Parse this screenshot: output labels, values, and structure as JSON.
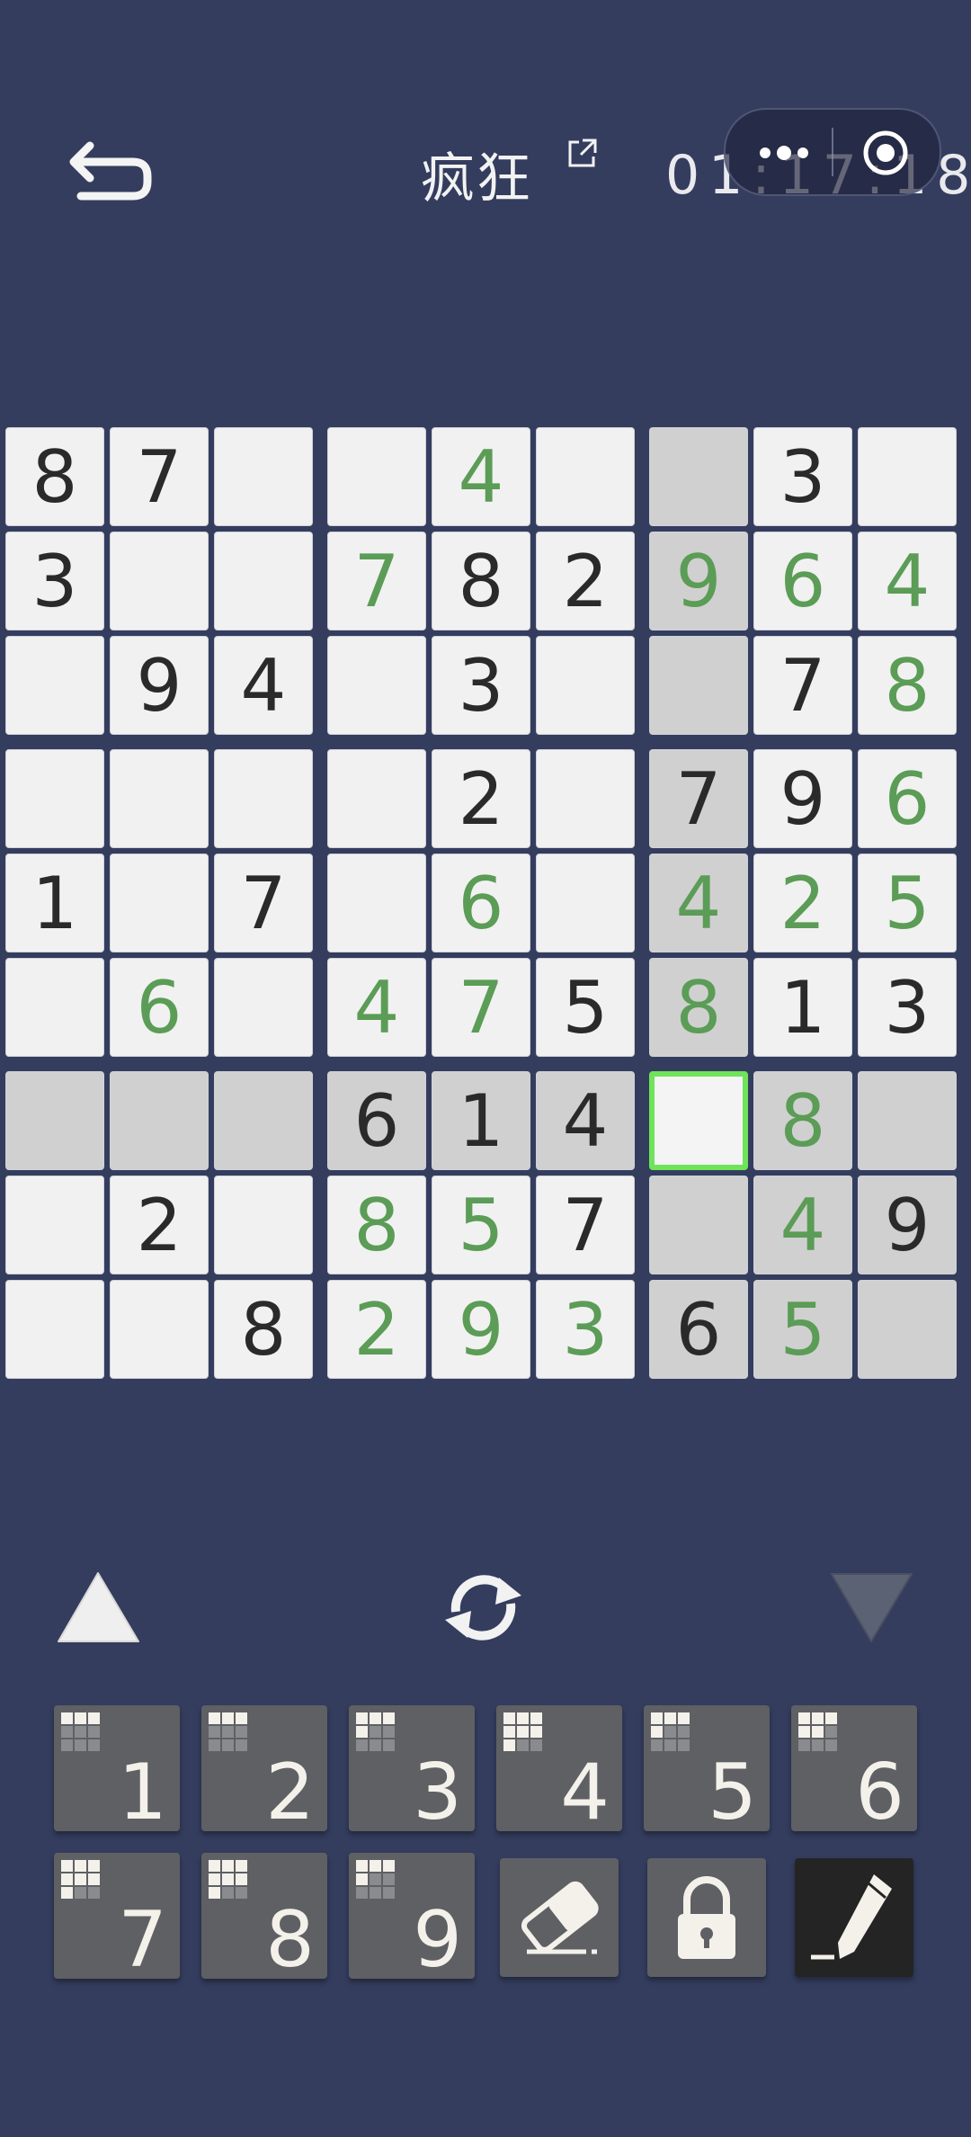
{
  "header": {
    "title": "疯狂",
    "timer": "01:17:18"
  },
  "board": {
    "rows": [
      [
        "8",
        "7",
        "",
        "",
        "4",
        "",
        "",
        "3",
        ""
      ],
      [
        "3",
        "",
        "",
        "7",
        "8",
        "2",
        "9",
        "6",
        "4"
      ],
      [
        "",
        "9",
        "4",
        "",
        "3",
        "",
        "",
        "7",
        "8"
      ],
      [
        "",
        "",
        "",
        "",
        "2",
        "",
        "7",
        "9",
        "6"
      ],
      [
        "1",
        "",
        "7",
        "",
        "6",
        "",
        "4",
        "2",
        "5"
      ],
      [
        "",
        "6",
        "",
        "4",
        "7",
        "5",
        "8",
        "1",
        "3"
      ],
      [
        "",
        "",
        "",
        "6",
        "1",
        "4",
        "",
        "8",
        ""
      ],
      [
        "",
        "2",
        "",
        "8",
        "5",
        "7",
        "",
        "4",
        "9"
      ],
      [
        "",
        "",
        "8",
        "2",
        "9",
        "3",
        "6",
        "5",
        ""
      ]
    ],
    "user_filled": [
      "0,4",
      "1,3",
      "1,6",
      "1,7",
      "1,8",
      "2,8",
      "3,8",
      "4,4",
      "4,6",
      "4,7",
      "4,8",
      "5,1",
      "5,3",
      "5,4",
      "5,6",
      "6,7",
      "7,3",
      "7,4",
      "7,7",
      "8,3",
      "8,4",
      "8,5",
      "8,7"
    ],
    "selected": "6,6",
    "colors": {
      "user_digit": "#5b9c56",
      "given_digit": "#2a2a2a",
      "selection": "#6fe35a",
      "highlight": "#d0d0d0"
    }
  },
  "numpad": {
    "digits": [
      {
        "label": "1",
        "remaining": 3
      },
      {
        "label": "2",
        "remaining": 3
      },
      {
        "label": "3",
        "remaining": 4
      },
      {
        "label": "4",
        "remaining": 7
      },
      {
        "label": "5",
        "remaining": 4
      },
      {
        "label": "6",
        "remaining": 5
      },
      {
        "label": "7",
        "remaining": 7
      },
      {
        "label": "8",
        "remaining": 7
      },
      {
        "label": "9",
        "remaining": 4
      }
    ]
  },
  "tools": [
    "eraser-icon",
    "lock-icon",
    "pencil-icon"
  ]
}
